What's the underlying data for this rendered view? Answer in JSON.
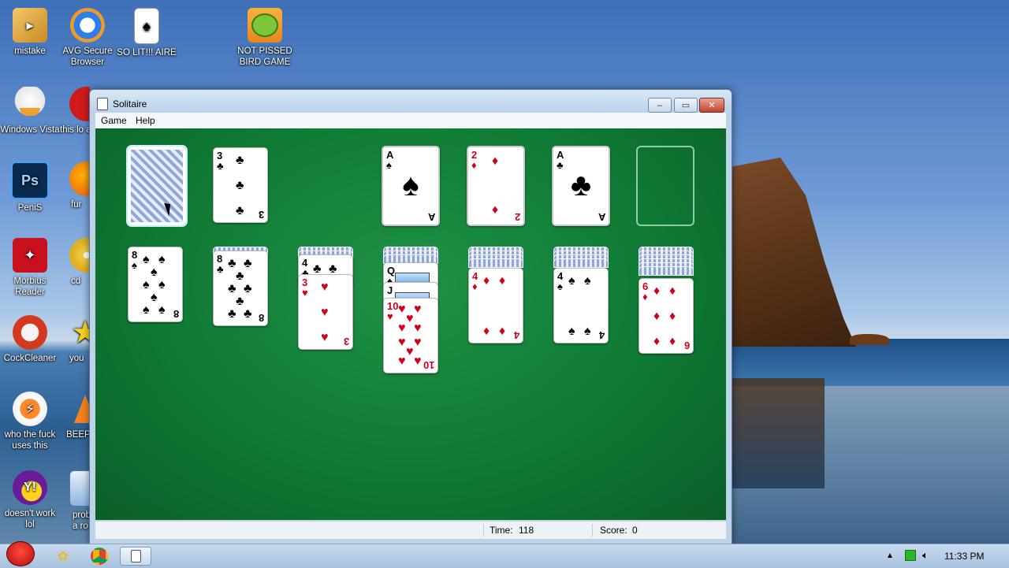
{
  "desktop": {
    "icons": [
      {
        "label": "mistake",
        "icon": "folder-arrow-icon"
      },
      {
        "label": "AVG Secure Browser",
        "icon": "avg-browser-icon"
      },
      {
        "label": "SO LIT!!! AIRE",
        "icon": "solitaire-card-icon"
      },
      {
        "label": "NOT PISSED BIRD GAME",
        "icon": "green-pig-icon"
      },
      {
        "label": "Windows Vista",
        "icon": "egg-icon"
      },
      {
        "label": "this lo a vagi",
        "icon": "red-circle-icon"
      },
      {
        "label": "Ps",
        "icon": "photoshop-icon"
      },
      {
        "label": "PeniS",
        "icon": ""
      },
      {
        "label": "fur",
        "icon": "firefox-icon"
      },
      {
        "label": "Morbius Reader",
        "icon": "acrobat-icon"
      },
      {
        "label": "cd",
        "icon": "cd-icon"
      },
      {
        "label": "CockCleaner",
        "icon": "ccleaner-icon"
      },
      {
        "label": "you",
        "icon": "star-icon"
      },
      {
        "label": "who the fuck uses this",
        "icon": "lightning-icon"
      },
      {
        "label": "BEEP",
        "icon": "vlc-cone-icon"
      },
      {
        "label": "doesn't work lol",
        "icon": "yahoo-messenger-icon"
      },
      {
        "label": "probab a ro",
        "icon": "document-icon"
      }
    ]
  },
  "window": {
    "title": "Solitaire",
    "controls": {
      "minimize": "‒",
      "maximize": "▭",
      "close": "✕"
    },
    "menu": [
      "Game",
      "Help"
    ],
    "status": {
      "time_label": "Time:",
      "time_value": "118",
      "score_label": "Score:",
      "score_value": "0"
    }
  },
  "game": {
    "stock": {
      "face_down": true
    },
    "waste": {
      "rank": "3",
      "suit": "♣",
      "color": "black"
    },
    "foundations": [
      {
        "rank": "A",
        "suit": "♠",
        "color": "black"
      },
      {
        "rank": "2",
        "suit": "♦",
        "color": "red"
      },
      {
        "rank": "A",
        "suit": "♣",
        "color": "black"
      },
      {
        "rank": "",
        "suit": "",
        "color": "empty"
      }
    ],
    "tableau": [
      {
        "hidden": 0,
        "cards": [
          {
            "rank": "8",
            "suit": "♠",
            "color": "black"
          }
        ]
      },
      {
        "hidden": 1,
        "cards": [
          {
            "rank": "8",
            "suit": "♣",
            "color": "black"
          }
        ]
      },
      {
        "hidden": 2,
        "cards": [
          {
            "rank": "4",
            "suit": "♣",
            "color": "black"
          },
          {
            "rank": "3",
            "suit": "♥",
            "color": "red"
          }
        ]
      },
      {
        "hidden": 3,
        "cards": [
          {
            "rank": "Q",
            "suit": "♠",
            "color": "black"
          },
          {
            "rank": "J",
            "suit": "♠",
            "color": "black"
          },
          {
            "rank": "10",
            "suit": "♥",
            "color": "red"
          }
        ]
      },
      {
        "hidden": 4,
        "cards": [
          {
            "rank": "4",
            "suit": "♦",
            "color": "red"
          }
        ]
      },
      {
        "hidden": 5,
        "cards": [
          {
            "rank": "4",
            "suit": "♠",
            "color": "black"
          }
        ]
      },
      {
        "hidden": 6,
        "cards": [
          {
            "rank": "6",
            "suit": "♦",
            "color": "red"
          }
        ]
      }
    ]
  },
  "taskbar": {
    "clock": "11:33 PM",
    "items": [
      "start-orb-icon",
      "explorer-icon",
      "chrome-icon",
      "solitaire-icon"
    ]
  },
  "colors": {
    "felt": "#0f7a35",
    "red_suit": "#d0021b",
    "black_suit": "#000000"
  }
}
